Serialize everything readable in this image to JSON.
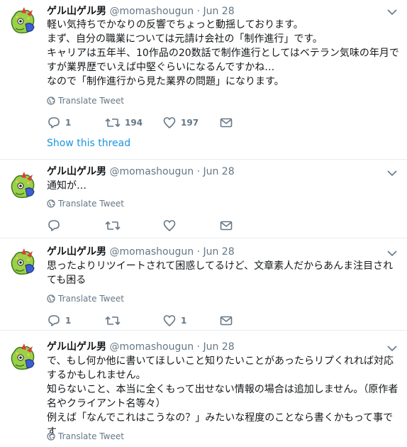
{
  "tweets": [
    {
      "name": "ゲル山ゲル男",
      "handle": "@momashougun",
      "separator": "·",
      "date": "Jun 28",
      "text": "軽い気持ちでかなりの反響でちょっと動揺しております。\nまず、自分の職業については元請け会社の「制作進行」です。\nキャリアは五年半、10作品の20数話で制作進行としてはベテラン気味の年月ですが業界歴でいえば中堅ぐらいになるんですかね…\nなので「制作進行から見た業界の問題」になります。",
      "translate": "Translate Tweet",
      "reply_count": "1",
      "retweet_count": "194",
      "like_count": "197",
      "show_thread": "Show this thread"
    },
    {
      "name": "ゲル山ゲル男",
      "handle": "@momashougun",
      "separator": "·",
      "date": "Jun 28",
      "text": "通知が…",
      "translate": "Translate Tweet",
      "reply_count": "",
      "retweet_count": "",
      "like_count": ""
    },
    {
      "name": "ゲル山ゲル男",
      "handle": "@momashougun",
      "separator": "·",
      "date": "Jun 28",
      "text": "思ったよりリツイートされて困惑してるけど、文章素人だからあんま注目されても困る",
      "translate": "Translate Tweet",
      "reply_count": "1",
      "retweet_count": "",
      "like_count": "1"
    },
    {
      "name": "ゲル山ゲル男",
      "handle": "@momashougun",
      "separator": "·",
      "date": "Jun 28",
      "text": "で、もし何か他に書いてほしいこと知りたいことがあったらリプくれれば対応するかもしれません。\n知らないこと、本当に全くもって出せない情報の場合は追加しません。（原作者名やクライアント名等々）\n例えば「なんでこれはこうなの？」みたいな程度のことなら書くかもって事です",
      "translate": "Translate Tweet"
    }
  ],
  "icons": {
    "avatar": "avatar-mascot-icon",
    "caret": "chevron-down-icon",
    "globe": "globe-icon",
    "reply": "reply-icon",
    "retweet": "retweet-icon",
    "like": "heart-icon",
    "dm": "envelope-icon"
  },
  "colors": {
    "link": "#1b95e0",
    "muted": "#657786",
    "text": "#14171a",
    "divider": "#e6ecf0"
  }
}
